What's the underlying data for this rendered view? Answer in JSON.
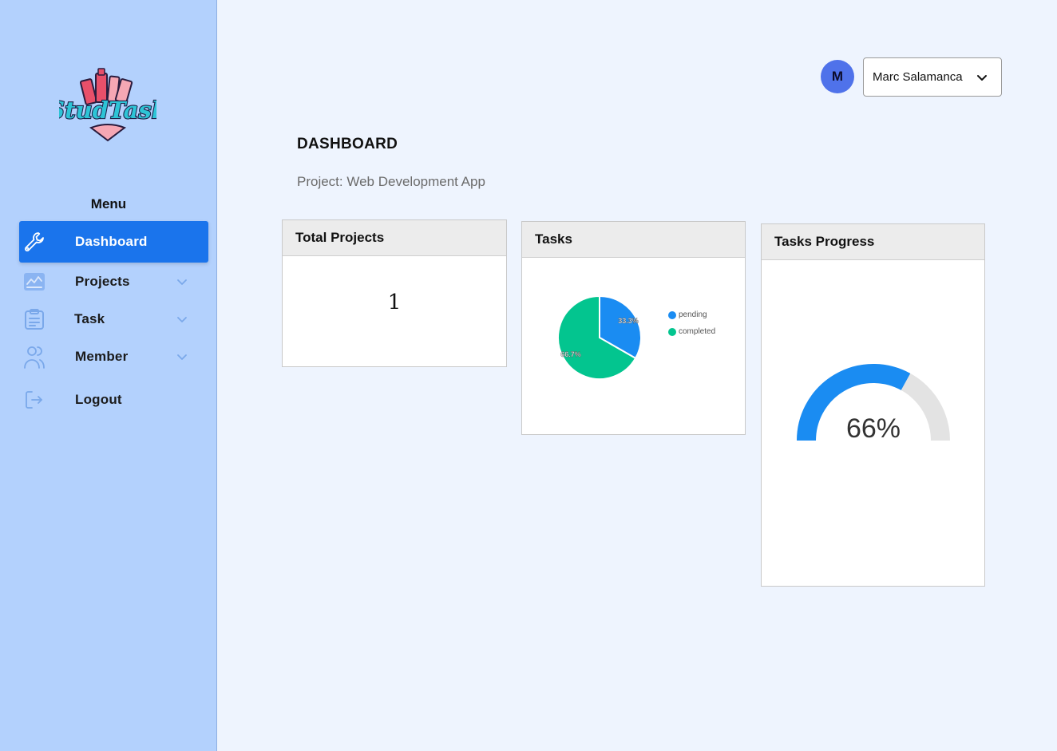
{
  "app": {
    "logo_text": "StudTask"
  },
  "sidebar": {
    "menu_title": "Menu",
    "items": [
      {
        "label": "Dashboard",
        "icon": "wrench-icon",
        "active": true,
        "has_dropdown": false
      },
      {
        "label": "Projects",
        "icon": "chart-icon",
        "active": false,
        "has_dropdown": true
      },
      {
        "label": "Task",
        "icon": "clipboard-icon",
        "active": false,
        "has_dropdown": true
      },
      {
        "label": "Member",
        "icon": "users-icon",
        "active": false,
        "has_dropdown": true
      },
      {
        "label": "Logout",
        "icon": "logout-icon",
        "active": false,
        "has_dropdown": false
      }
    ]
  },
  "header": {
    "avatar_initial": "M",
    "user_name": "Marc Salamanca"
  },
  "main": {
    "title": "DASHBOARD",
    "project_label": "Project: Web Development App"
  },
  "cards": {
    "total_projects": {
      "title": "Total Projects",
      "value": "1"
    },
    "tasks": {
      "title": "Tasks"
    },
    "tasks_progress": {
      "title": "Tasks Progress"
    }
  },
  "chart_data": [
    {
      "type": "pie",
      "slices": [
        {
          "name": "pending",
          "value": 33.3,
          "label": "33.3%",
          "color": "#1a8cf2"
        },
        {
          "name": "completed",
          "value": 66.7,
          "label": "66.7%",
          "color": "#03c58f"
        }
      ],
      "legend_placement": "right"
    },
    {
      "type": "gauge",
      "value": 66,
      "max": 100,
      "label": "66%",
      "fill_color": "#1a8cf2",
      "track_color": "#e3e3e3"
    }
  ],
  "colors": {
    "sidebar_bg": "#b3d1fd",
    "accent": "#1a74ec",
    "page_bg": "#eef4fe",
    "avatar_bg": "#4f72ea"
  }
}
